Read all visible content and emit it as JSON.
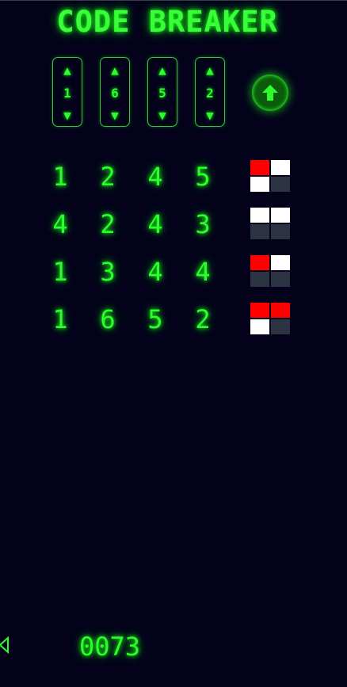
{
  "title": "CODE BREAKER",
  "selectors": [
    {
      "up_icon": "triangle-up-icon",
      "digit": "1",
      "down_icon": "triangle-down-icon"
    },
    {
      "up_icon": "triangle-up-icon",
      "digit": "6",
      "down_icon": "triangle-down-icon"
    },
    {
      "up_icon": "triangle-up-icon",
      "digit": "5",
      "down_icon": "triangle-down-icon"
    },
    {
      "up_icon": "triangle-up-icon",
      "digit": "2",
      "down_icon": "triangle-down-icon"
    }
  ],
  "submit_icon": "arrow-up-icon",
  "guesses": [
    {
      "digits": [
        "1",
        "2",
        "4",
        "5"
      ],
      "feedback": [
        "red",
        "white",
        "white",
        "empty"
      ]
    },
    {
      "digits": [
        "4",
        "2",
        "4",
        "3"
      ],
      "feedback": [
        "white",
        "white",
        "empty",
        "empty"
      ]
    },
    {
      "digits": [
        "1",
        "3",
        "4",
        "4"
      ],
      "feedback": [
        "red",
        "white",
        "empty",
        "empty"
      ]
    },
    {
      "digits": [
        "1",
        "6",
        "5",
        "2"
      ],
      "feedback": [
        "red",
        "red",
        "white",
        "empty"
      ]
    }
  ],
  "feedback_colors": {
    "red": "#ff0000",
    "white": "#ffffff",
    "empty": "#2c3444"
  },
  "back_icon": "triangle-left-icon",
  "counter": "0073",
  "colors": {
    "background": "#03021a",
    "accent": "#2bff2b"
  }
}
